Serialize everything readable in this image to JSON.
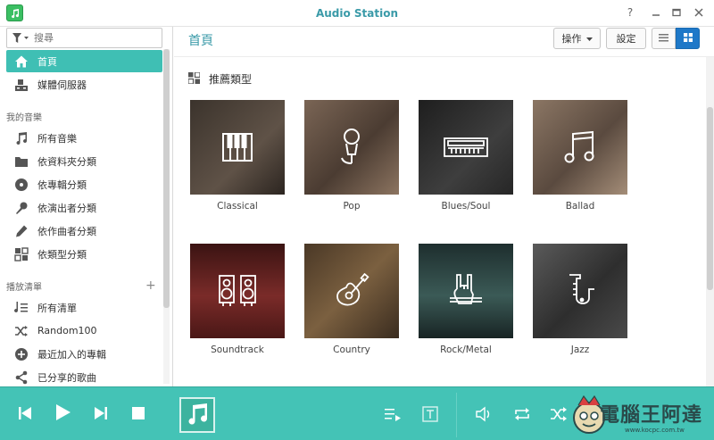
{
  "window": {
    "title": "Audio Station"
  },
  "sidebar": {
    "search": {
      "placeholder": "搜尋"
    },
    "items": [
      {
        "label": "首頁",
        "icon": "home-icon",
        "active": true
      },
      {
        "label": "媒體伺服器",
        "icon": "media-server-icon",
        "active": false
      }
    ],
    "my_music": {
      "label": "我的音樂",
      "items": [
        {
          "label": "所有音樂",
          "icon": "music-note-icon"
        },
        {
          "label": "依資料夾分類",
          "icon": "folder-icon"
        },
        {
          "label": "依專輯分類",
          "icon": "album-icon"
        },
        {
          "label": "依演出者分類",
          "icon": "microphone-icon"
        },
        {
          "label": "依作曲者分類",
          "icon": "pen-icon"
        },
        {
          "label": "依類型分類",
          "icon": "grid-icon"
        }
      ]
    },
    "playlists": {
      "label": "播放清單",
      "items": [
        {
          "label": "所有清單",
          "icon": "playlist-icon"
        },
        {
          "label": "Random100",
          "icon": "shuffle-icon"
        },
        {
          "label": "最近加入的專輯",
          "icon": "plus-circle-icon"
        },
        {
          "label": "已分享的歌曲",
          "icon": "share-icon"
        }
      ]
    }
  },
  "main": {
    "title": "首頁",
    "actions_label": "操作",
    "settings_label": "設定",
    "section_title": "推薦類型",
    "genres": [
      {
        "label": "Classical",
        "icon": "piano-icon",
        "bg": "#4a3f36"
      },
      {
        "label": "Pop",
        "icon": "microphone-icon",
        "bg": "#5b4a3e"
      },
      {
        "label": "Blues/Soul",
        "icon": "keyboard-icon",
        "bg": "#2f2f2f"
      },
      {
        "label": "Ballad",
        "icon": "music-note-icon",
        "bg": "#6b5a4c"
      },
      {
        "label": "Soundtrack",
        "icon": "speakers-icon",
        "bg": "#6a2a28"
      },
      {
        "label": "Country",
        "icon": "guitar-icon",
        "bg": "#5e4a34"
      },
      {
        "label": "Rock/Metal",
        "icon": "rock-hand-icon",
        "bg": "#2a3a3a"
      },
      {
        "label": "Jazz",
        "icon": "saxophone-icon",
        "bg": "#3d3d3d"
      }
    ]
  },
  "player": {
    "controls": [
      "previous-icon",
      "play-icon",
      "next-icon",
      "stop-icon"
    ],
    "right_controls": [
      "queue-icon",
      "lyrics-icon",
      "volume-icon",
      "repeat-icon",
      "shuffle-icon"
    ]
  },
  "watermark": {
    "text": "電腦王阿達",
    "url": "www.kocpc.com.tw"
  },
  "colors": {
    "accent": "#3fbfb4",
    "player_bg": "#44c3b6",
    "title_color": "#3a9aa8"
  }
}
